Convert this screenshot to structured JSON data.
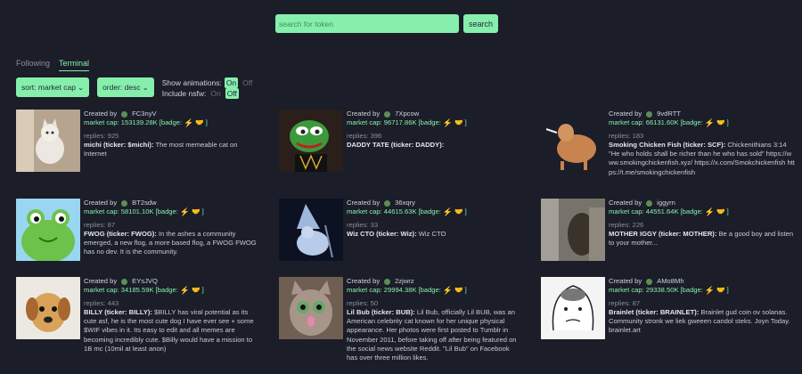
{
  "search": {
    "placeholder": "search for token",
    "button_label": "search"
  },
  "tabs": [
    {
      "label": "Following"
    },
    {
      "label": "Terminal"
    }
  ],
  "controls": {
    "sort_label": "sort: market cap",
    "order_label": "order: desc",
    "show_animations_label": "Show animations:",
    "include_nsfw_label": "Include nsfw:",
    "on_label": "On",
    "off_label": "Off"
  },
  "colors": {
    "accent": "#86efac",
    "background": "#1b1d28"
  },
  "cards": [
    {
      "created_by": "Created by",
      "creator": "FC3nyV",
      "market_cap": "market cap: 153139.28K",
      "badge": "[badge:",
      "replies": "replies: 925",
      "title": "michi (ticker: $michi):",
      "description": " The most memeable cat on Internet"
    },
    {
      "created_by": "Created by",
      "creator": "7Xpcow",
      "market_cap": "market cap: 96717.86K",
      "badge": "[badge:",
      "replies": "replies: 396",
      "title": "DADDY TATE (ticker: DADDY):",
      "description": ""
    },
    {
      "created_by": "Created by",
      "creator": "9vdRTT",
      "market_cap": "market cap: 66131.60K",
      "badge": "[badge:",
      "replies": "replies: 183",
      "title": "Smoking Chicken Fish (ticker: SCF):",
      "description": " Chickenithians 3:14 \"He who holds shall be richer than he who has sold\" https://www.smokingchickenfish.xyz/ https://x.com/Smokchickenfish https://t.me/smokingchickenfish"
    },
    {
      "created_by": "Created by",
      "creator": "BT2sdw",
      "market_cap": "market cap: 58101.10K",
      "badge": "[badge:",
      "replies": "replies: 87",
      "title": "FWOG (ticker: FWOG):",
      "description": " In the ashes a community emerged, a new flog, a more based flog, a FWOG FWOG has no dev. It is the community."
    },
    {
      "created_by": "Created by",
      "creator": "36xqry",
      "market_cap": "market cap: 44615.63K",
      "badge": "[badge:",
      "replies": "replies: 33",
      "title": "Wiz CTO (ticker: Wiz):",
      "description": " Wiz CTO"
    },
    {
      "created_by": "Created by",
      "creator": "iggyrn",
      "market_cap": "market cap: 44551.64K",
      "badge": "[badge:",
      "replies": "replies: 226",
      "title": "MOTHER IGGY (ticker: MOTHER):",
      "description": " Be a good boy and listen to your mother..."
    },
    {
      "created_by": "Created by",
      "creator": "EYsJVQ",
      "market_cap": "market cap: 34185.59K",
      "badge": "[badge:",
      "replies": "replies: 443",
      "title": "BILLY (ticker: BILLY):",
      "description": " $BILLY has viral potential as its cute asf, he is the most cute dog I have ever see + some $WIF vibes in it. Its easy to edit and all memes are becoming incredibly cute. $Billy would have a mission to 1B mc (10mil at least anon)"
    },
    {
      "created_by": "Created by",
      "creator": "2zjwrz",
      "market_cap": "market cap: 29994.38K",
      "badge": "[badge:",
      "replies": "replies: 50",
      "title": "Lil Bub (ticker: BUB):",
      "description": " Lil Bub, officially Lil BUB, was an American celebrity cat known for her unique physical appearance. Her photos were first posted to Tumblr in November 2011, before taking off after being featured on the social news website Reddit. \"Lil Bub\" on Facebook has over three million likes."
    },
    {
      "created_by": "Created by",
      "creator": "AMo8Mh",
      "market_cap": "market cap: 29338.50K",
      "badge": "[badge:",
      "replies": "replies: 87",
      "title": "Brainlet (ticker: BRAINLET):",
      "description": " Brainlet gud coin ov solanas. Community stronk we liek gweeen candol steks. Joyn Today. brainlet.art"
    }
  ]
}
